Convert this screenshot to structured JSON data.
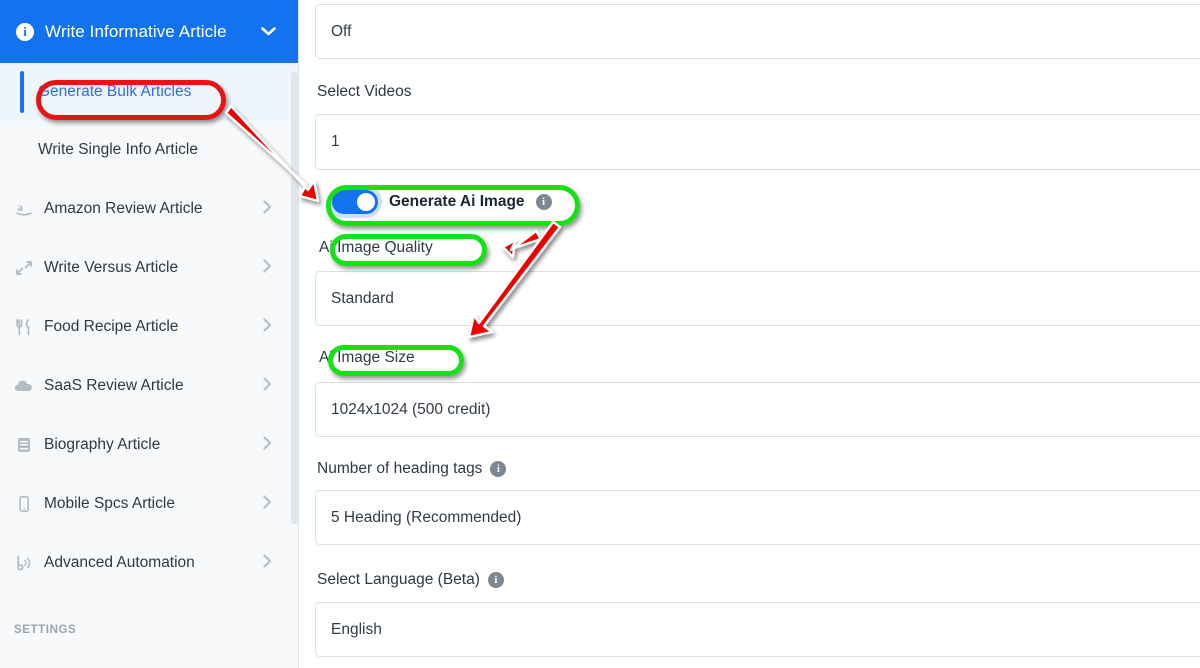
{
  "sidebar": {
    "header": {
      "title": "Write Informative Article",
      "info_icon": "info-circle-icon",
      "caret_icon": "chevron-down-icon",
      "bg_color": "#1272f0"
    },
    "subitems": [
      {
        "label": "Generate Bulk Articles",
        "active": true
      },
      {
        "label": "Write Single Info Article",
        "active": false
      }
    ],
    "navitems": [
      {
        "label": "Amazon Review Article",
        "icon": "amazon-icon",
        "caret": "chevron-right-icon"
      },
      {
        "label": "Write Versus Article",
        "icon": "versus-arrows-icon",
        "caret": "chevron-right-icon"
      },
      {
        "label": "Food Recipe Article",
        "icon": "fork-knife-icon",
        "caret": "chevron-right-icon"
      },
      {
        "label": "SaaS Review Article",
        "icon": "cloud-icon",
        "caret": "chevron-right-icon"
      },
      {
        "label": "Biography Article",
        "icon": "book-icon",
        "caret": "chevron-right-icon"
      },
      {
        "label": "Mobile Spcs Article",
        "icon": "mobile-phone-icon",
        "caret": "chevron-right-icon"
      },
      {
        "label": "Advanced Automation",
        "icon": "broadcast-icon",
        "caret": "chevron-right-icon"
      }
    ],
    "section_label": "SETTINGS"
  },
  "form": {
    "fields": [
      {
        "label": "",
        "value": "Off",
        "name": "off-select"
      },
      {
        "label": "Select Videos",
        "value": "1",
        "name": "select-videos"
      },
      {
        "label": "Ai Image Quality",
        "value": "Standard",
        "name": "ai-image-quality"
      },
      {
        "label": "Ai Image Size",
        "value": "1024x1024 (500 credit)",
        "name": "ai-image-size"
      },
      {
        "label": "Number of heading tags",
        "value": "5 Heading (Recommended)",
        "name": "heading-tags",
        "has_info": true
      },
      {
        "label": "Select Language (Beta)",
        "value": "English",
        "name": "select-language",
        "has_info": true
      }
    ],
    "toggle": {
      "label": "Generate Ai Image",
      "state": "on",
      "info_icon": "info-circle-icon"
    }
  },
  "annotations": {
    "red_highlight_color": "#e81313",
    "green_highlight_color": "#16e016",
    "arrow_color": "#ee0000",
    "arrows": [
      {
        "name": "arrow-to-generate-ai-image-toggle"
      },
      {
        "name": "arrow-to-ai-image-quality"
      },
      {
        "name": "arrow-to-ai-image-size"
      }
    ],
    "highlights": [
      {
        "name": "highlight-generate-bulk-articles",
        "color": "red"
      },
      {
        "name": "highlight-generate-ai-image-toggle",
        "color": "green"
      },
      {
        "name": "highlight-ai-image-quality-label",
        "color": "green"
      },
      {
        "name": "highlight-ai-image-size-label",
        "color": "green"
      }
    ]
  }
}
